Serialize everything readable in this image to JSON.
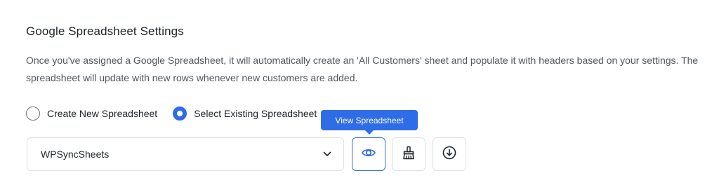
{
  "settings": {
    "title": "Google Spreadsheet Settings",
    "description": "Once you've assigned a Google Spreadsheet, it will automatically create an 'All Customers' sheet and populate it with headers based on your settings. The spreadsheet will update with new rows whenever new customers are added."
  },
  "radio_options": {
    "create_new": {
      "label": "Create New Spreadsheet",
      "checked": false
    },
    "select_existing": {
      "label": "Select Existing Spreadsheet",
      "checked": true
    }
  },
  "tooltip": {
    "text": "View Spreadsheet"
  },
  "spreadsheet_select": {
    "selected_value": "WPSyncSheets"
  },
  "action_buttons": {
    "view": {
      "icon": "eye-icon",
      "active": true
    },
    "clean": {
      "icon": "broom-icon"
    },
    "download": {
      "icon": "download-icon"
    }
  },
  "colors": {
    "accent": "#2f6de6",
    "text_primary": "#1d2327",
    "text_secondary": "#50575e",
    "border": "#dcdfe4"
  }
}
